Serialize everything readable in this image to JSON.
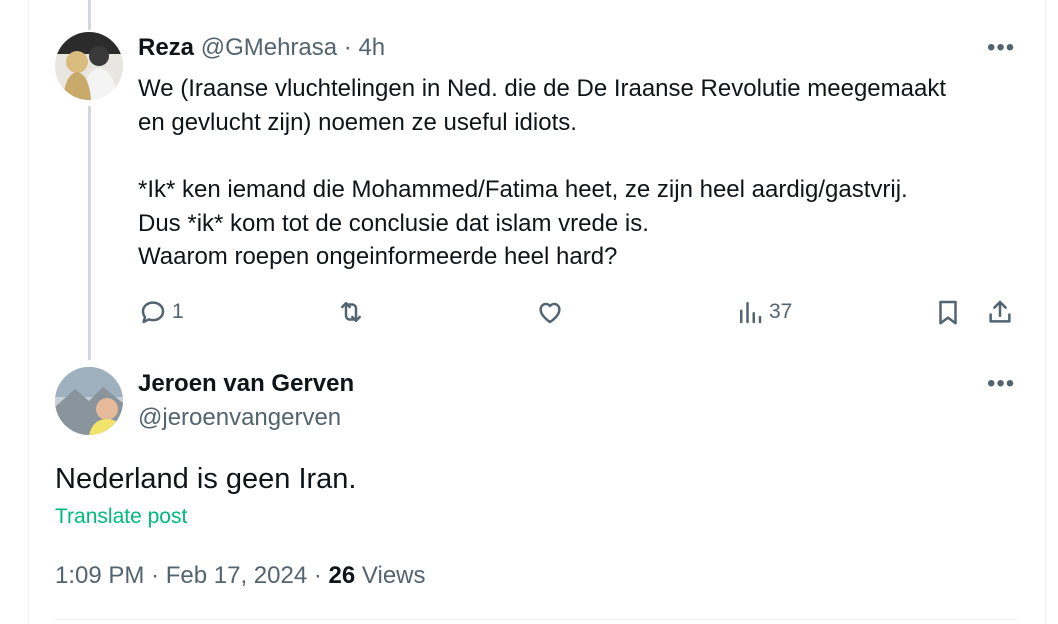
{
  "reply_parent": {
    "author_name": "Reza",
    "handle": "@GMehrasa",
    "separator": "·",
    "time": "4h",
    "more_label": "•••",
    "body": [
      "We (Iraanse vluchtelingen in Ned. die de De Iraanse Revolutie meegemaakt",
      "en gevlucht zijn) noemen ze useful idiots.",
      "",
      "*Ik* ken iemand die Mohammed/Fatima heet, ze zijn heel aardig/gastvrij.",
      "Dus *ik* kom tot de conclusie dat islam  vrede is.",
      "Waarom roepen ongeinformeerde heel hard?"
    ],
    "actions": {
      "reply_count": "1",
      "views_count": "37"
    }
  },
  "main_post": {
    "author_name": "Jeroen van Gerven",
    "handle": "@jeroenvangerven",
    "more_label": "•••",
    "text": "Nederland is geen Iran.",
    "translate_label": "Translate post",
    "time": "1:09 PM",
    "dot1": "·",
    "date": "Feb 17, 2024",
    "dot2": "·",
    "views_count": "26",
    "views_label": "Views"
  },
  "colors": {
    "text": "#0f1419",
    "muted": "#536471",
    "thread_line": "#cfd9de",
    "translate": "#00ba7c"
  },
  "icons": [
    "reply-icon",
    "retweet-icon",
    "like-icon",
    "views-icon",
    "bookmark-icon",
    "share-icon"
  ]
}
